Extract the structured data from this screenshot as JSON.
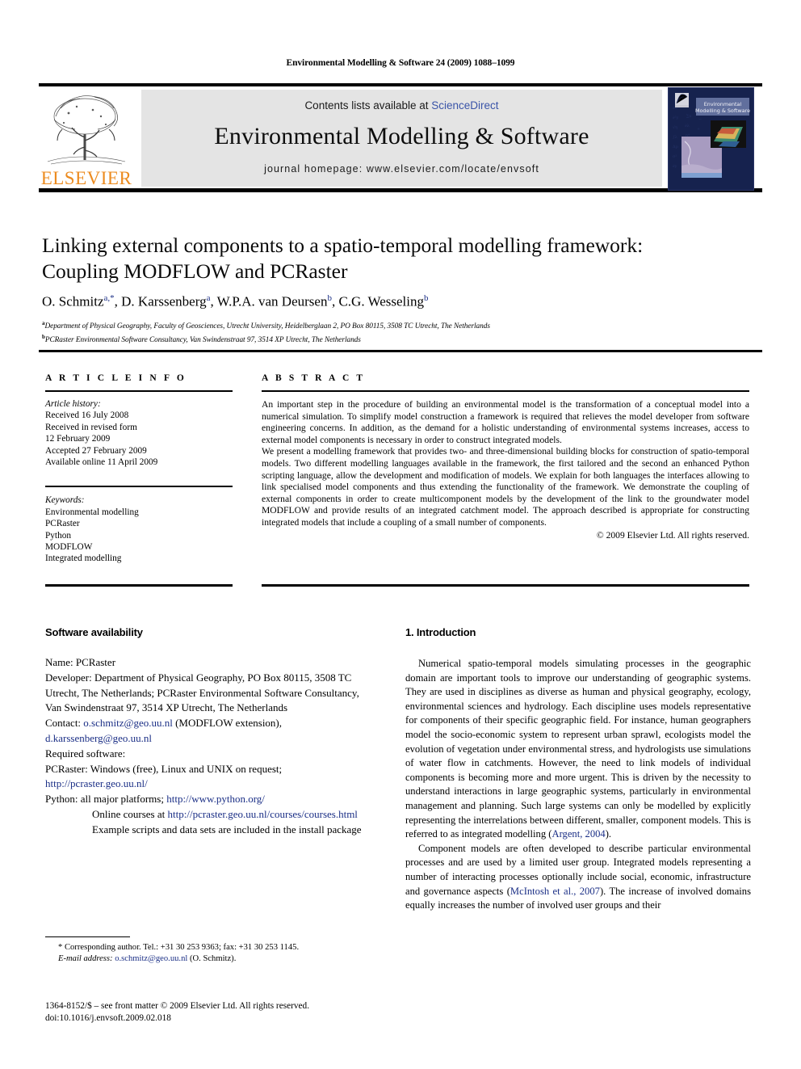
{
  "running_head": "Environmental Modelling & Software 24 (2009) 1088–1099",
  "masthead": {
    "publisher_logo_label": "ELSEVIER",
    "contents_prefix": "Contents lists available at ",
    "contents_link": "ScienceDirect",
    "journal_name": "Environmental Modelling & Software",
    "homepage": "journal homepage: www.elsevier.com/locate/envsoft",
    "cover_title_line1": "Environmental",
    "cover_title_line2": "Modelling & Software"
  },
  "article": {
    "title_line1": "Linking external components to a spatio-temporal modelling framework:",
    "title_line2": "Coupling MODFLOW and PCRaster",
    "authors": "O. Schmitz",
    "authors_full": [
      {
        "name": "O. Schmitz",
        "marks": "a,*"
      },
      {
        "name": "D. Karssenberg",
        "marks": "a"
      },
      {
        "name": "W.P.A. van Deursen",
        "marks": "b"
      },
      {
        "name": "C.G. Wesseling",
        "marks": "b"
      }
    ],
    "affiliation_a_mark": "a",
    "affiliation_a": "Department of Physical Geography, Faculty of Geosciences, Utrecht University, Heidelberglaan 2, PO Box 80115, 3508 TC Utrecht, The Netherlands",
    "affiliation_b_mark": "b",
    "affiliation_b": "PCRaster Environmental Software Consultancy, Van Swindenstraat 97, 3514 XP Utrecht, The Netherlands"
  },
  "article_info": {
    "heading": "A R T I C L E  I N F O",
    "history_label": "Article history:",
    "history": [
      "Received 16 July 2008",
      "Received in revised form",
      "12 February 2009",
      "Accepted 27 February 2009",
      "Available online 11 April 2009"
    ],
    "keywords_label": "Keywords:",
    "keywords": [
      "Environmental modelling",
      "PCRaster",
      "Python",
      "MODFLOW",
      "Integrated modelling"
    ]
  },
  "abstract": {
    "heading": "A B S T R A C T",
    "paragraph1": "An important step in the procedure of building an environmental model is the transformation of a conceptual model into a numerical simulation. To simplify model construction a framework is required that relieves the model developer from software engineering concerns. In addition, as the demand for a holistic understanding of environmental systems increases, access to external model components is necessary in order to construct integrated models.",
    "paragraph2": "We present a modelling framework that provides two- and three-dimensional building blocks for construction of spatio-temporal models. Two different modelling languages available in the framework, the first tailored and the second an enhanced Python scripting language, allow the development and modification of models. We explain for both languages the interfaces allowing to link specialised model components and thus extending the functionality of the framework. We demonstrate the coupling of external components in order to create multicomponent models by the development of the link to the groundwater model MODFLOW and provide results of an integrated catchment model. The approach described is appropriate for constructing integrated models that include a coupling of a small number of components.",
    "copyright": "© 2009 Elsevier Ltd. All rights reserved."
  },
  "software_availability": {
    "heading": "Software availability",
    "name_label": "Name:",
    "name_value": "PCRaster",
    "developer_label": "Developer:",
    "developer_value": "Department of Physical Geography, PO Box 80115, 3508 TC Utrecht, The Netherlands; PCRaster Environmental Software Consultancy, Van Swindenstraat 97, 3514 XP Utrecht, The Netherlands",
    "contact_label": "Contact:",
    "contact_email1": "o.schmitz@geo.uu.nl",
    "contact_email1_note": "(MODFLOW extension),",
    "contact_email2": "d.karssenberg@geo.uu.nl",
    "required_label": "Required software:",
    "pcraster_line": "PCRaster: Windows (free), Linux and UNIX on request;",
    "pcraster_url": "http://pcraster.geo.uu.nl/",
    "python_line": "Python: all major platforms;",
    "python_url": "http://www.python.org/",
    "courses_prefix": "Online courses at",
    "courses_url": "http://pcraster.geo.uu.nl/courses/courses.html",
    "example_note": "Example scripts and data sets are included in the install package"
  },
  "introduction": {
    "heading": "1.  Introduction",
    "paragraph1": "Numerical spatio-temporal models simulating processes in the geographic domain are important tools to improve our understanding of geographic systems. They are used in disciplines as diverse as human and physical geography, ecology, environmental sciences and hydrology. Each discipline uses models representative for components of their specific geographic field. For instance, human geographers model the socio-economic system to represent urban sprawl, ecologists model the evolution of vegetation under environmental stress, and hydrologists use simulations of water flow in catchments. However, the need to link models of individual components is becoming more and more urgent. This is driven by the necessity to understand interactions in large geographic systems, particularly in environmental management and planning. Such large systems can only be modelled by explicitly representing the interrelations between different, smaller, component models. This is referred to as integrated modelling (",
    "paragraph1_citation": "Argent, 2004",
    "paragraph1_end": ").",
    "paragraph2_a": "Component models are often developed to describe particular environmental processes and are used by a limited user group. Integrated models representing a number of interacting processes optionally include social, economic, infrastructure and governance aspects (",
    "paragraph2_citation": "McIntosh et al., 2007",
    "paragraph2_b": "). The increase of involved domains equally increases the number of involved user groups and their"
  },
  "footnote": {
    "corresponding": "* Corresponding author. Tel.: +31 30 253 9363; fax: +31 30 253 1145.",
    "email_label": "E-mail address:",
    "email": "o.schmitz@geo.uu.nl",
    "email_suffix": "(O. Schmitz)."
  },
  "footer": {
    "line1": "1364-8152/$ – see front matter © 2009 Elsevier Ltd. All rights reserved.",
    "line2": "doi:10.1016/j.envsoft.2009.02.018"
  },
  "colors": {
    "link_blue": "#1b2f86",
    "sciencedirect_blue": "#3a54a8",
    "elsevier_orange": "#ec8b1f",
    "banner_gray": "#e4e4e4",
    "cover_navy": "#16224e"
  }
}
